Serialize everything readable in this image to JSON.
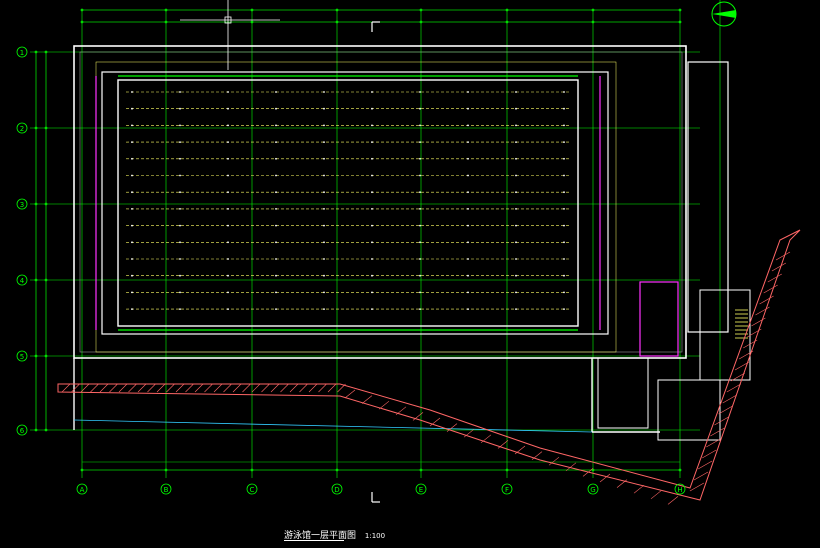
{
  "drawing": {
    "title": "游泳馆一层平面图",
    "scale": "1:100",
    "colors": {
      "background": "#000000",
      "axis": "#00ff00",
      "wall": "#ffffff",
      "lane": "#ffff66",
      "hatch": "#ff6666",
      "magenta": "#ff33ff",
      "cyan": "#33ccff",
      "dim": "#00dd00"
    },
    "column_grid_labels": [
      "A",
      "B",
      "C",
      "D",
      "E",
      "F",
      "G",
      "H"
    ],
    "row_grid_labels": [
      "1",
      "2",
      "3",
      "4",
      "5",
      "6"
    ]
  }
}
